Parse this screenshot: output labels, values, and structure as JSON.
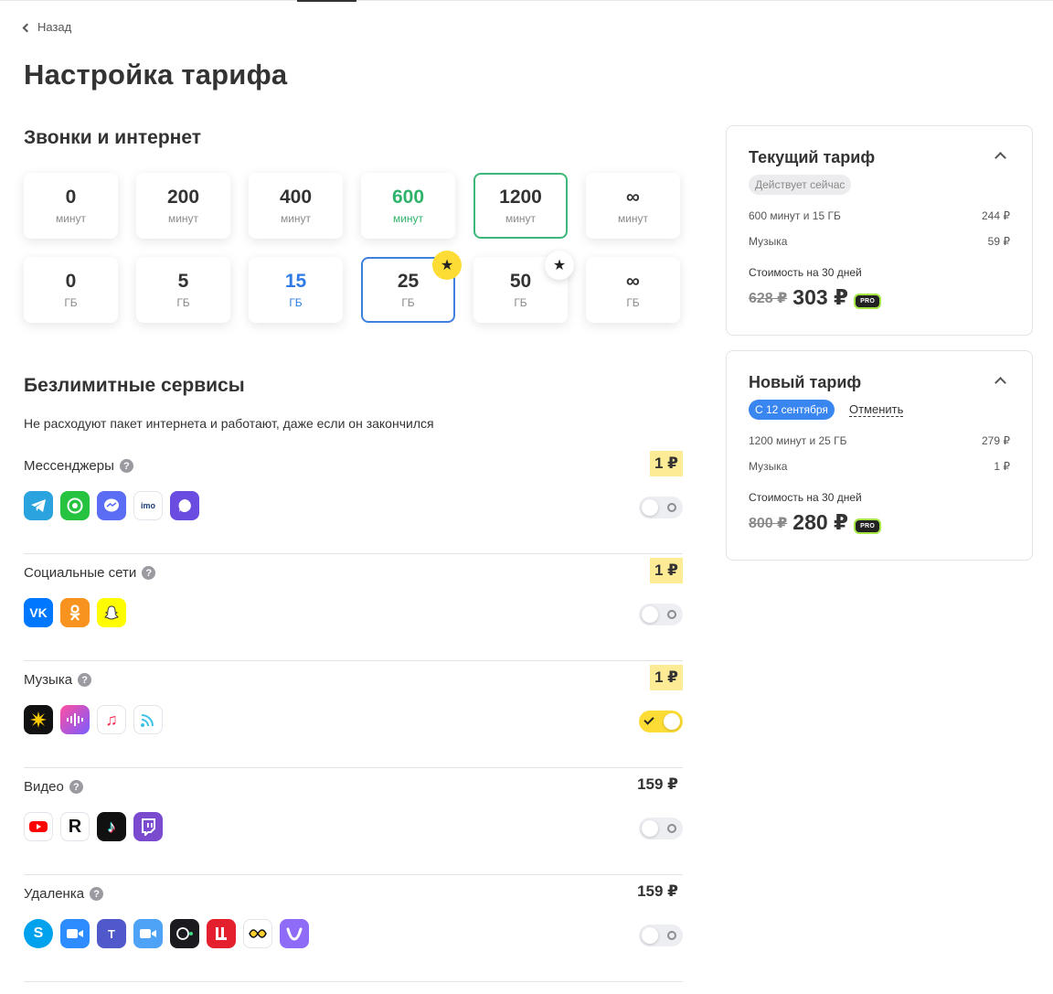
{
  "nav": {
    "back_label": "Назад"
  },
  "page_title": "Настройка тарифа",
  "calls_section": {
    "title": "Звонки и интернет",
    "minutes": [
      {
        "value": "0",
        "unit": "минут",
        "state": "default"
      },
      {
        "value": "200",
        "unit": "минут",
        "state": "default"
      },
      {
        "value": "400",
        "unit": "минут",
        "state": "default"
      },
      {
        "value": "600",
        "unit": "минут",
        "state": "current"
      },
      {
        "value": "1200",
        "unit": "минут",
        "state": "selected"
      },
      {
        "value": "∞",
        "unit": "минут",
        "state": "default"
      }
    ],
    "gigabytes": [
      {
        "value": "0",
        "unit": "ГБ",
        "state": "default"
      },
      {
        "value": "5",
        "unit": "ГБ",
        "state": "default"
      },
      {
        "value": "15",
        "unit": "ГБ",
        "state": "current"
      },
      {
        "value": "25",
        "unit": "ГБ",
        "state": "selected",
        "badge": "star-yellow"
      },
      {
        "value": "50",
        "unit": "ГБ",
        "state": "default",
        "badge": "star-white"
      },
      {
        "value": "∞",
        "unit": "ГБ",
        "state": "default"
      }
    ]
  },
  "services_section": {
    "title": "Безлимитные сервисы",
    "subtitle": "Не расходуют пакет интернета и работают, даже если он закончился",
    "items": [
      {
        "name": "Мессенджеры",
        "price": "1 ₽",
        "highlight": true,
        "enabled": false,
        "apps": [
          "telegram-icon",
          "whatsapp-icon",
          "messenger-icon",
          "imo-icon",
          "tamtam-icon"
        ]
      },
      {
        "name": "Социальные сети",
        "price": "1 ₽",
        "highlight": true,
        "enabled": false,
        "apps": [
          "vk-icon",
          "odnoklassniki-icon",
          "snapchat-icon"
        ]
      },
      {
        "name": "Музыка",
        "price": "1 ₽",
        "highlight": true,
        "enabled": true,
        "apps": [
          "yandex-music-icon",
          "zvuk-icon",
          "apple-music-icon",
          "podcasts-icon"
        ]
      },
      {
        "name": "Видео",
        "price": "159 ₽",
        "highlight": false,
        "enabled": false,
        "apps": [
          "youtube-icon",
          "rutube-icon",
          "tiktok-icon",
          "twitch-icon"
        ]
      },
      {
        "name": "Удаленка",
        "price": "159 ₽",
        "highlight": false,
        "enabled": false,
        "apps": [
          "skype-icon",
          "zoom-icon",
          "teams-icon",
          "facetime-icon",
          "webcam-icon",
          "lingualeo-icon",
          "miro-icon",
          "viber-icon"
        ]
      }
    ]
  },
  "current_plan": {
    "title": "Текущий тариф",
    "badge": "Действует сейчас",
    "rows": [
      {
        "label": "600 минут и 15 ГБ",
        "price": "244 ₽"
      },
      {
        "label": "Музыка",
        "price": "59 ₽"
      }
    ],
    "cost_label": "Стоимость на 30 дней",
    "old_price": "628 ₽",
    "new_price": "303 ₽",
    "pro_label": "PRO"
  },
  "new_plan": {
    "title": "Новый тариф",
    "badge": "С 12 сентября",
    "cancel_label": "Отменить",
    "rows": [
      {
        "label": "1200 минут и 25 ГБ",
        "price": "279 ₽"
      },
      {
        "label": "Музыка",
        "price": "1 ₽"
      }
    ],
    "cost_label": "Стоимость на 30 дней",
    "old_price": "800 ₽",
    "new_price": "280 ₽",
    "pro_label": "PRO"
  },
  "colors": {
    "accent_yellow": "#fddd35",
    "current_green": "#2fb36a",
    "selected_blue": "#3f7fde",
    "price_highlight": "#fdeb95"
  }
}
